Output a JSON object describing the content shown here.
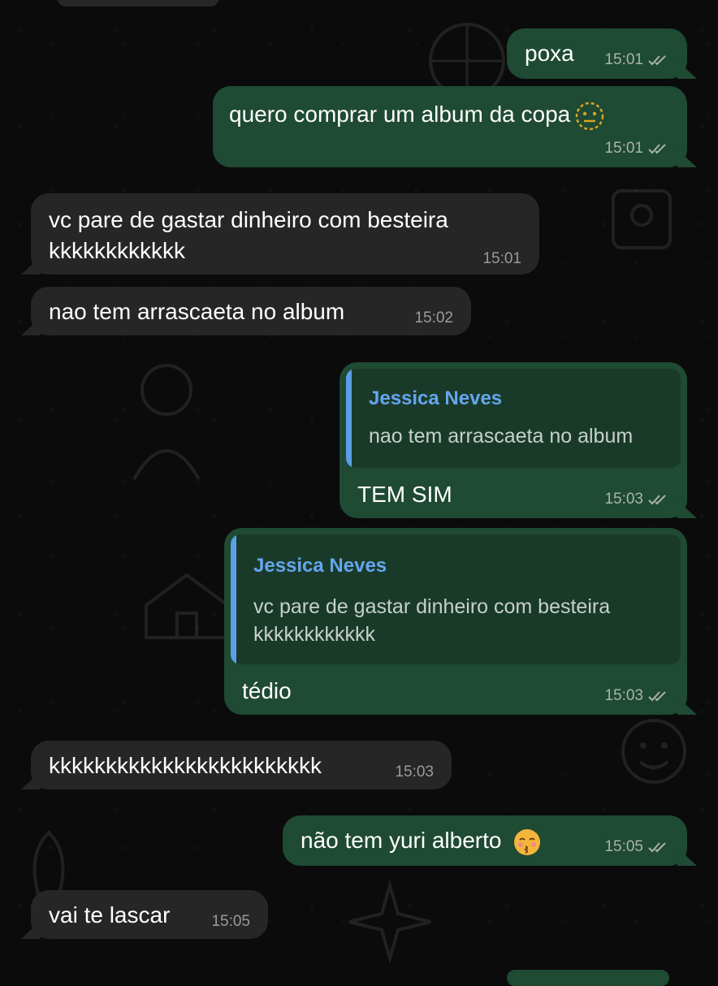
{
  "chat": {
    "messages": [
      {
        "dir": "out",
        "text": "poxa",
        "time": "15:01"
      },
      {
        "dir": "out",
        "text": "quero comprar um album da copa",
        "emoji": "neutral-face",
        "time": "15:01"
      },
      {
        "dir": "in",
        "text": "vc pare de gastar dinheiro com besteira\nkkkkkkkkkkkk",
        "time": "15:01"
      },
      {
        "dir": "in",
        "text": "nao tem arrascaeta no album",
        "time": "15:02"
      },
      {
        "dir": "out",
        "reply": {
          "author": "Jessica Neves",
          "text": "nao tem arrascaeta no album"
        },
        "text": "TEM SIM",
        "time": "15:03"
      },
      {
        "dir": "out",
        "reply": {
          "author": "Jessica Neves",
          "text": "vc pare de gastar dinheiro com besteira\nkkkkkkkkkkkk"
        },
        "text": "tédio",
        "time": "15:03"
      },
      {
        "dir": "in",
        "text": "kkkkkkkkkkkkkkkkkkkkkkkk",
        "time": "15:03"
      },
      {
        "dir": "out",
        "text": "não tem yuri alberto",
        "emoji": "kissing-face",
        "time": "15:05"
      },
      {
        "dir": "in",
        "text": "vai te lascar",
        "time": "15:05"
      }
    ]
  },
  "colors": {
    "outgoing_bubble": "#1f4a34",
    "incoming_bubble": "#262627",
    "quote_bar": "#5b9fe8",
    "quote_author": "#64a6ee",
    "background": "#0b0b0b"
  },
  "icons": {
    "read_receipt": "double-check-icon"
  }
}
